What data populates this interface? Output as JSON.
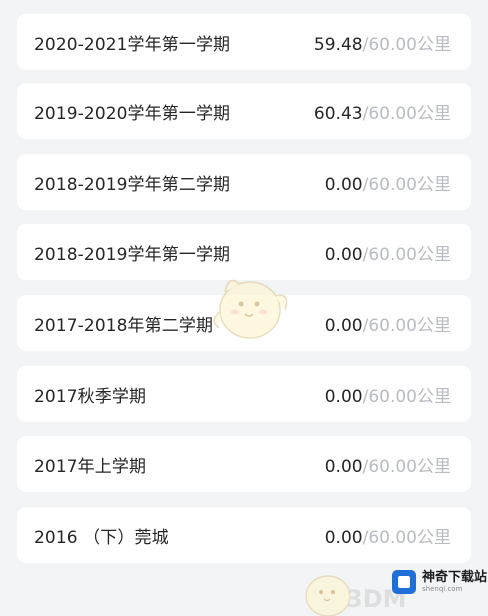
{
  "terms": [
    {
      "term": "2020-2021学年第一学期",
      "distance": "59.48",
      "separator": "/",
      "goal": "60.00",
      "unit": "公里"
    },
    {
      "term": "2019-2020学年第一学期",
      "distance": "60.43",
      "separator": "/",
      "goal": "60.00",
      "unit": "公里"
    },
    {
      "term": "2018-2019学年第二学期",
      "distance": "0.00",
      "separator": "/",
      "goal": "60.00",
      "unit": "公里"
    },
    {
      "term": "2018-2019学年第一学期",
      "distance": "0.00",
      "separator": "/",
      "goal": "60.00",
      "unit": "公里"
    },
    {
      "term": "2017-2018年第二学期",
      "distance": "0.00",
      "separator": "/",
      "goal": "60.00",
      "unit": "公里"
    },
    {
      "term": "2017秋季学期",
      "distance": "0.00",
      "separator": "/",
      "goal": "60.00",
      "unit": "公里"
    },
    {
      "term": "2017年上学期",
      "distance": "0.00",
      "separator": "/",
      "goal": "60.00",
      "unit": "公里"
    },
    {
      "term": "2016 （下）莞城",
      "distance": "0.00",
      "separator": "/",
      "goal": "60.00",
      "unit": "公里"
    }
  ],
  "watermark": {
    "brand": "神奇下载站",
    "brand_sub": "shenqi.com",
    "text_3d": "3DM",
    "icons": [
      "mascot-icon",
      "logo-icon"
    ]
  },
  "colors": {
    "background": "#f3f4f6",
    "card": "#ffffff",
    "text": "#262626",
    "muted": "#b9bcc2"
  }
}
